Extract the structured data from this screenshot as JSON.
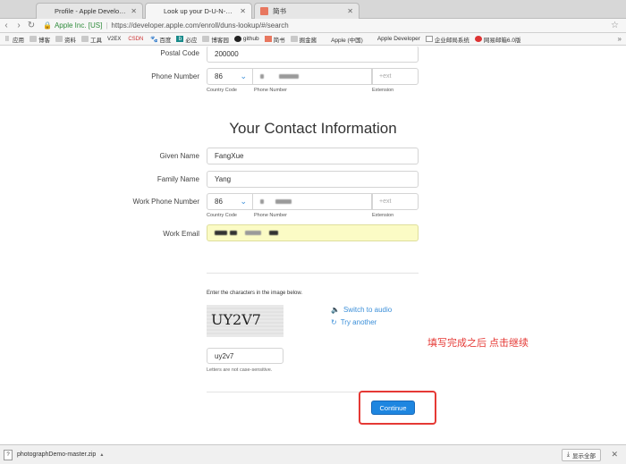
{
  "tabs": [
    {
      "title": "Profile - Apple Developer Prog",
      "close": "✕",
      "active": false
    },
    {
      "title": "Look up your D-U-N-S Numbe",
      "close": "✕",
      "active": true
    },
    {
      "title": "简书",
      "close": "✕",
      "active": false
    }
  ],
  "address": {
    "org": "Apple Inc. [US]",
    "url": "https://developer.apple.com/enroll/duns-lookup/#/search"
  },
  "bookmarks": [
    "应用",
    "博客",
    "资料",
    "工具",
    "V2EX",
    "CSDN",
    "百度",
    "必应",
    "博客园",
    "github",
    "简书",
    "掘金酱",
    "Apple (中国)",
    "Apple Developer",
    "企业邮局系统",
    "网易邮箱6.0版"
  ],
  "form": {
    "postal_code_label": "Postal Code",
    "postal_code_value": "200000",
    "phone_label": "Phone Number",
    "phone_cc": "86",
    "country_code_label": "Country Code",
    "phone_number_label": "Phone Number",
    "extension_label": "Extension",
    "ext_placeholder": "+ext",
    "contact_heading": "Your Contact Information",
    "given_name_label": "Given Name",
    "given_name_value": "FangXue",
    "family_name_label": "Family Name",
    "family_name_value": "Yang",
    "work_phone_label": "Work Phone Number",
    "work_phone_cc": "86",
    "work_email_label": "Work Email",
    "captcha_prompt": "Enter the characters in the image below.",
    "captcha_image_text": "UY2V7",
    "switch_audio": "Switch to audio",
    "try_another": "Try another",
    "captcha_value": "uy2v7",
    "case_note": "Letters are not case-sensitive.",
    "continue_label": "Continue"
  },
  "annotation": "填写完成之后 点击继续",
  "download": {
    "filename": "photographDemo-master.zip",
    "show_all": "显示全部"
  },
  "colors": {
    "accent": "#1e86e0",
    "annotation_red": "#e53935",
    "autofill_yellow": "#fbfbc5"
  }
}
